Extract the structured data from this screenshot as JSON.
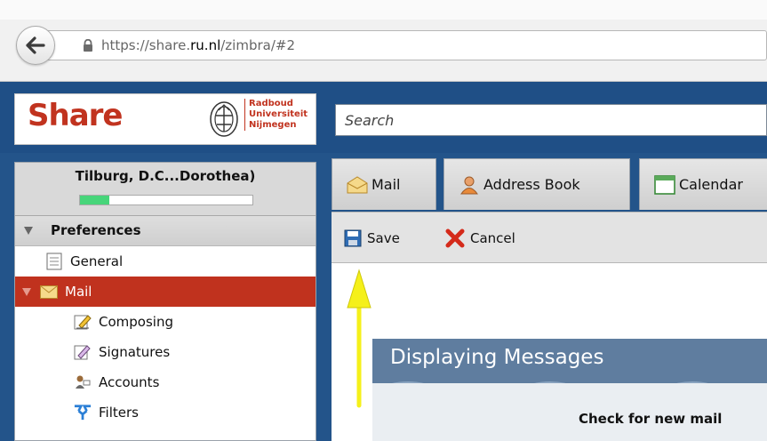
{
  "browser": {
    "url_prefix": "https://share.",
    "url_domain": "ru.nl",
    "url_suffix": "/zimbra/#2"
  },
  "header": {
    "logo_text": "Share",
    "university_lines": [
      "Radboud",
      "Universiteit",
      "Nijmegen"
    ],
    "search_placeholder": "Search"
  },
  "sidebar": {
    "user_name": "Tilburg, D.C...Dorothea)",
    "quota_fraction": 0.17,
    "section_title": "Preferences",
    "items": [
      {
        "label": "General",
        "icon": "general-icon"
      },
      {
        "label": "Mail",
        "icon": "mail-icon"
      },
      {
        "label": "Composing",
        "icon": "composing-icon"
      },
      {
        "label": "Signatures",
        "icon": "signatures-icon"
      },
      {
        "label": "Accounts",
        "icon": "accounts-icon"
      },
      {
        "label": "Filters",
        "icon": "filters-icon"
      }
    ]
  },
  "tabs": [
    {
      "label": "Mail",
      "icon": "envelope-icon"
    },
    {
      "label": "Address Book",
      "icon": "address-book-icon"
    },
    {
      "label": "Calendar",
      "icon": "calendar-icon"
    }
  ],
  "toolbar": {
    "save_label": "Save",
    "cancel_label": "Cancel"
  },
  "content": {
    "section_title": "Displaying Messages",
    "check_label": "Check for new mail"
  },
  "colors": {
    "brand_red": "#c1331f",
    "app_blue": "#23548a",
    "selected_bg": "#c0321e",
    "annotation_arrow": "#f5f01a"
  }
}
